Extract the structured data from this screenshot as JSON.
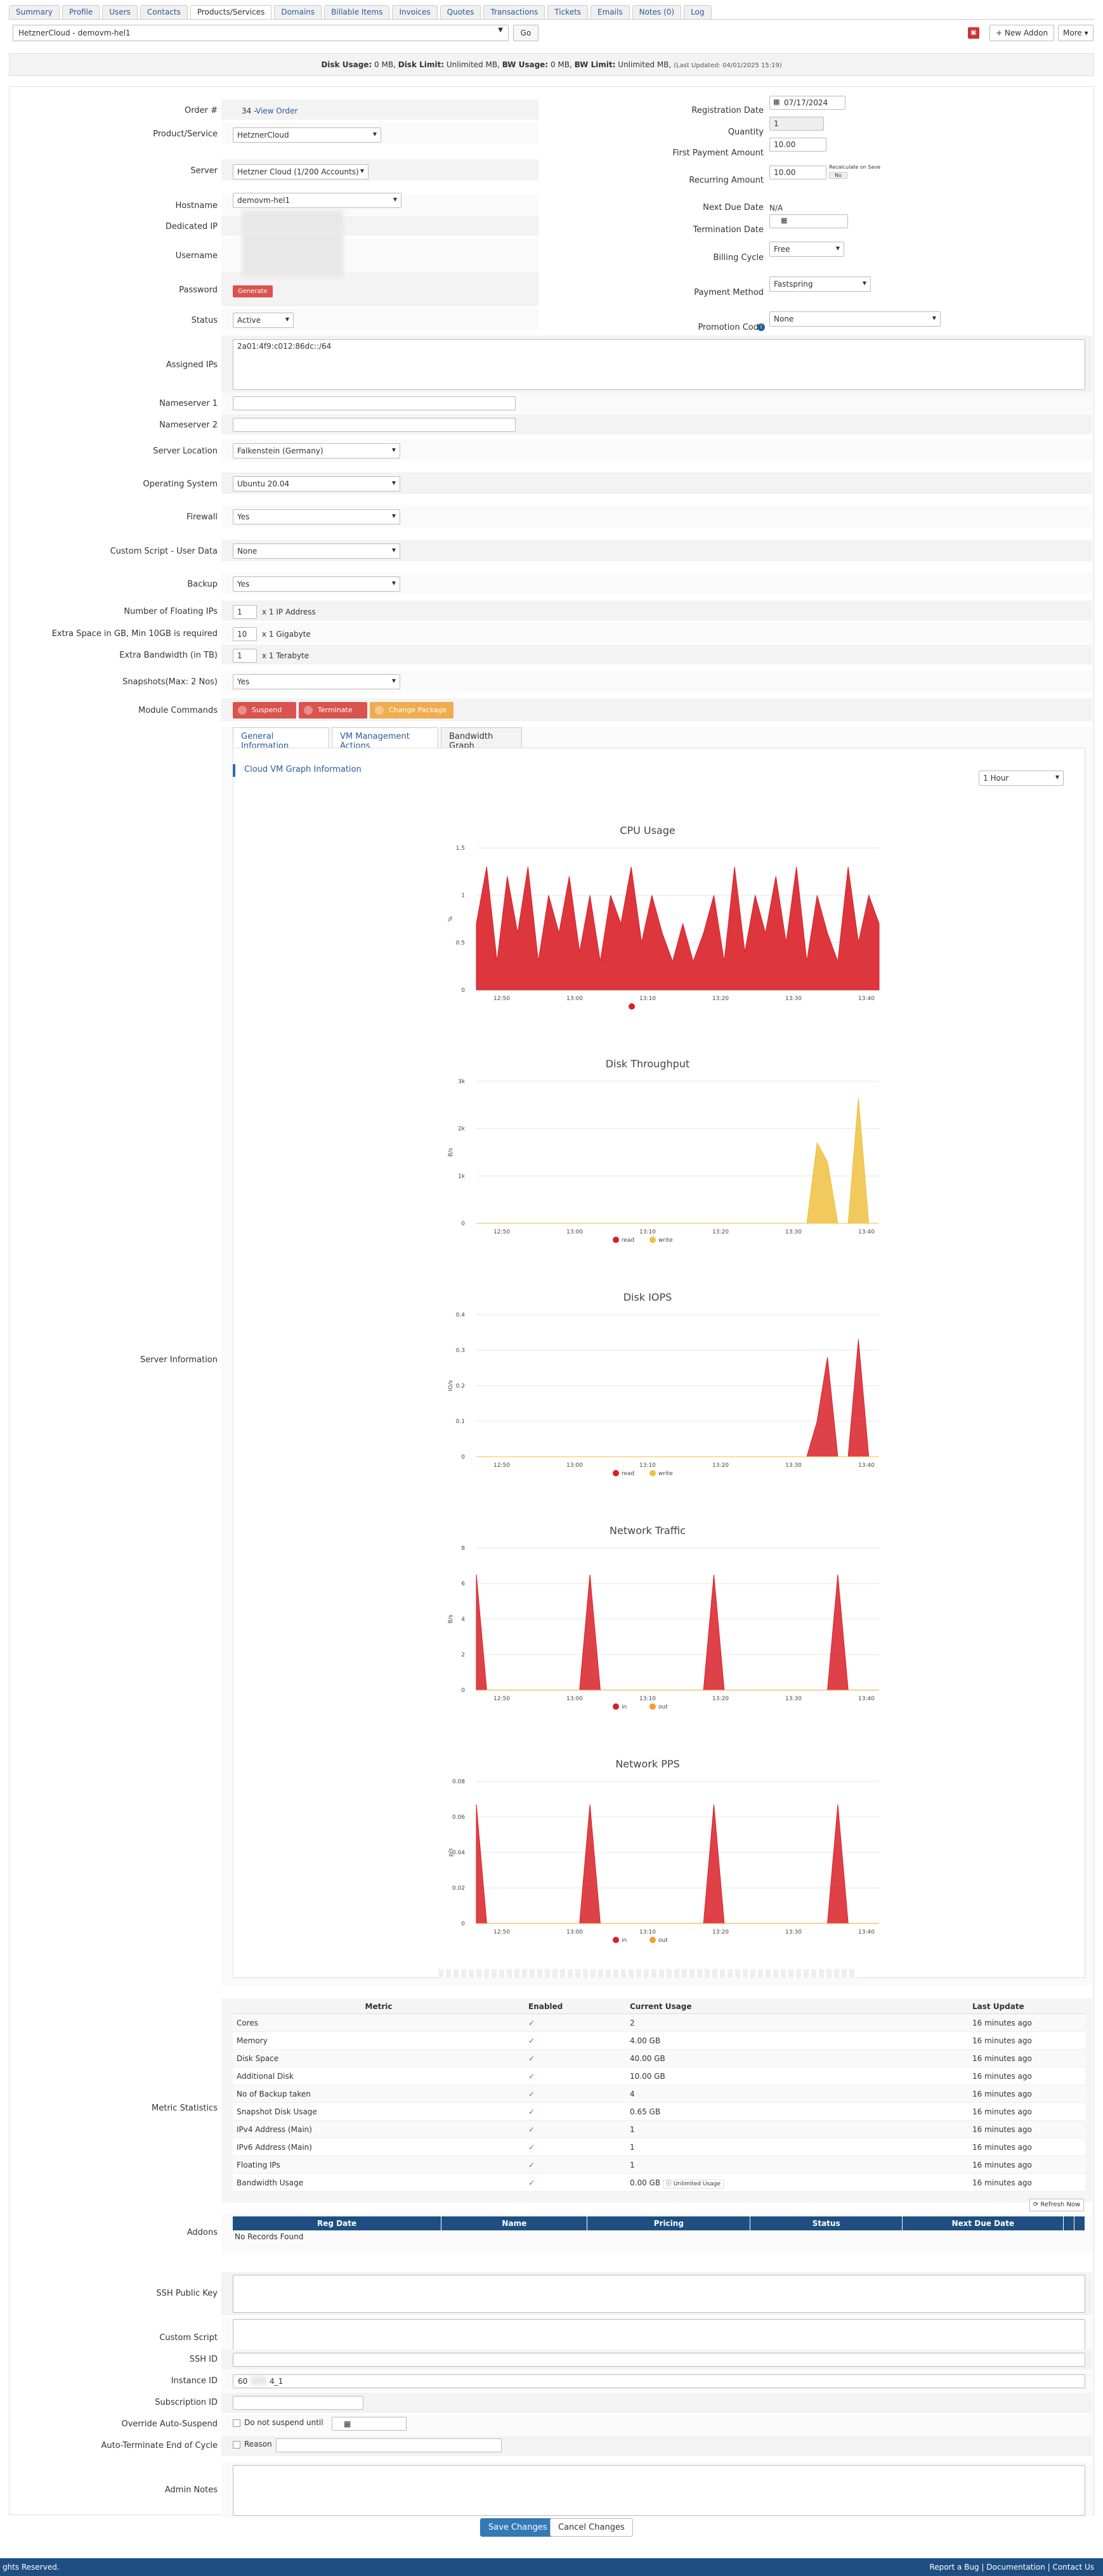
{
  "tabs": [
    "Summary",
    "Profile",
    "Users",
    "Contacts",
    "Products/Services",
    "Domains",
    "Billable Items",
    "Invoices",
    "Quotes",
    "Transactions",
    "Tickets",
    "Emails",
    "Notes (0)",
    "Log"
  ],
  "active_tab": 4,
  "service_select": "HetznerCloud - demovm-hel1",
  "go_label": "Go",
  "new_addon_label": "New Addon",
  "more_label": "More",
  "usage": {
    "disk_usage_label": "Disk Usage:",
    "disk_usage": "0 MB,",
    "disk_limit_label": "Disk Limit:",
    "disk_limit": "Unlimited MB,",
    "bw_usage_label": "BW Usage:",
    "bw_usage": "0 MB,",
    "bw_limit_label": "BW Limit:",
    "bw_limit": "Unlimited MB,",
    "updated": "(Last Updated: 04/01/2025 15:19)"
  },
  "form": {
    "order_label": "Order #",
    "order_value": "34 - ",
    "view_order": "View Order",
    "product_label": "Product/Service",
    "product_value": "HetznerCloud",
    "server_label": "Server",
    "server_value": "Hetzner Cloud (1/200 Accounts)",
    "hostname_label": "Hostname",
    "hostname_value": "demovm-hel1",
    "dedicated_ip_label": "Dedicated IP",
    "username_label": "Username",
    "password_label": "Password",
    "generate_label": "Generate",
    "status_label": "Status",
    "status_value": "Active",
    "assigned_ips_label": "Assigned IPs",
    "assigned_ips_value": "2a01:4f9:c012:86dc::/64",
    "ns1_label": "Nameserver 1",
    "ns2_label": "Nameserver 2",
    "location_label": "Server Location",
    "location_value": "Falkenstein (Germany)",
    "os_label": "Operating System",
    "os_value": "Ubuntu 20.04",
    "firewall_label": "Firewall",
    "firewall_value": "Yes",
    "custom_script_label": "Custom Script - User Data",
    "custom_script_value": "None",
    "backup_label": "Backup",
    "backup_value": "Yes",
    "floating_label": "Number of Floating IPs",
    "floating_value": "1",
    "floating_unit": "x 1 IP Address",
    "extra_space_label": "Extra Space in GB, Min 10GB is required",
    "extra_space_value": "10",
    "extra_space_unit": "x 1 Gigabyte",
    "extra_bw_label": "Extra Bandwidth (in TB)",
    "extra_bw_value": "1",
    "extra_bw_unit": "x 1 Terabyte",
    "snapshots_label": "Snapshots(Max: 2 Nos)",
    "snapshots_value": "Yes",
    "module_label": "Module Commands",
    "suspend_label": "Suspend",
    "terminate_label": "Terminate",
    "change_pkg_label": "Change Package",
    "reg_date_label": "Registration Date",
    "reg_date_value": "07/17/2024",
    "quantity_label": "Quantity",
    "quantity_value": "1",
    "first_payment_label": "First Payment Amount",
    "first_payment_value": "10.00",
    "recurring_label": "Recurring Amount",
    "recurring_value": "10.00",
    "recalc_label": "Recalculate on Save",
    "recalc_value": "No",
    "next_due_label": "Next Due Date",
    "next_due_value": "N/A",
    "term_date_label": "Termination Date",
    "billing_cycle_label": "Billing Cycle",
    "billing_cycle_value": "Free",
    "payment_method_label": "Payment Method",
    "payment_method_value": "Fastspring",
    "promo_label": "Promotion Code",
    "promo_value": "None"
  },
  "server_info_label": "Server Information",
  "subtabs": [
    "General Information",
    "VM Management Actions",
    "Bandwidth Graph"
  ],
  "graph_header": "Cloud VM Graph Information",
  "period_value": "1 Hour",
  "chart_data": [
    {
      "type": "area",
      "title": "CPU Usage",
      "ylabel": "%",
      "x": [
        "12:50",
        "13:00",
        "13:10",
        "13:20",
        "13:30",
        "13:40"
      ],
      "ylim": [
        0,
        1.5
      ],
      "yticks": [
        "0",
        "0.5",
        "1",
        "1.5"
      ],
      "series": [
        {
          "values": [
            0.7,
            1.3,
            0.3,
            1.2,
            0.6,
            1.3,
            0.3,
            1.0,
            0.6,
            1.2,
            0.4,
            1.0,
            0.3,
            1.0,
            0.7,
            1.3,
            0.5,
            1.0,
            0.6,
            0.3,
            0.7,
            0.3,
            0.6,
            1.0,
            0.3,
            1.3,
            0.4,
            1.0,
            0.6,
            1.2,
            0.5,
            1.3,
            0.3,
            1.0,
            0.6,
            0.3,
            1.3,
            0.5,
            1.0,
            0.7
          ]
        }
      ],
      "legend": [
        ""
      ],
      "colors": [
        "#d92028"
      ]
    },
    {
      "type": "area",
      "title": "Disk Throughput",
      "ylabel": "B/s",
      "x": [
        "12:50",
        "13:00",
        "13:10",
        "13:20",
        "13:30",
        "13:40"
      ],
      "ylim": [
        0,
        3000
      ],
      "yticks": [
        "0",
        "1k",
        "2k",
        "3k"
      ],
      "series": [
        {
          "values": [
            0,
            0,
            0,
            0,
            0,
            0,
            0,
            0,
            0,
            0,
            0,
            0,
            0,
            0,
            0,
            0,
            0,
            0,
            0,
            0,
            0,
            0,
            0,
            0,
            0,
            0,
            0,
            0,
            0,
            0,
            0,
            0,
            0,
            0,
            0,
            0,
            0,
            0,
            0,
            0
          ]
        },
        {
          "values": [
            0,
            0,
            0,
            0,
            0,
            0,
            0,
            0,
            0,
            0,
            0,
            0,
            0,
            0,
            0,
            0,
            0,
            0,
            0,
            0,
            0,
            0,
            0,
            0,
            0,
            0,
            0,
            0,
            0,
            0,
            0,
            0,
            0,
            1700,
            1300,
            0,
            0,
            2650,
            0,
            0
          ]
        }
      ],
      "legend": [
        "read",
        "write"
      ],
      "colors": [
        "#d92028",
        "#f0c040"
      ]
    },
    {
      "type": "area",
      "title": "Disk IOPS",
      "ylabel": "IO/s",
      "x": [
        "12:50",
        "13:00",
        "13:10",
        "13:20",
        "13:30",
        "13:40"
      ],
      "ylim": [
        0,
        0.4
      ],
      "yticks": [
        "0",
        "0.1",
        "0.2",
        "0.3",
        "0.4"
      ],
      "series": [
        {
          "values": [
            0,
            0,
            0,
            0,
            0,
            0,
            0,
            0,
            0,
            0,
            0,
            0,
            0,
            0,
            0,
            0,
            0,
            0,
            0,
            0,
            0,
            0,
            0,
            0,
            0,
            0,
            0,
            0,
            0,
            0,
            0,
            0,
            0,
            0.1,
            0.28,
            0,
            0,
            0.33,
            0,
            0
          ]
        },
        {
          "values": [
            0,
            0,
            0,
            0,
            0,
            0,
            0,
            0,
            0,
            0,
            0,
            0,
            0,
            0,
            0,
            0,
            0,
            0,
            0,
            0,
            0,
            0,
            0,
            0,
            0,
            0,
            0,
            0,
            0,
            0,
            0,
            0,
            0,
            0,
            0,
            0,
            0,
            0,
            0,
            0
          ]
        }
      ],
      "legend": [
        "read",
        "write"
      ],
      "colors": [
        "#d92028",
        "#f0c040"
      ]
    },
    {
      "type": "area",
      "title": "Network Traffic",
      "ylabel": "B/s",
      "x": [
        "12:50",
        "13:00",
        "13:10",
        "13:20",
        "13:30",
        "13:40"
      ],
      "ylim": [
        0,
        8
      ],
      "yticks": [
        "0",
        "2",
        "4",
        "6",
        "8"
      ],
      "series": [
        {
          "values": [
            6.5,
            0,
            0,
            0,
            0,
            0,
            0,
            0,
            0,
            0,
            0,
            6.5,
            0,
            0,
            0,
            0,
            0,
            0,
            0,
            0,
            0,
            0,
            0,
            6.5,
            0,
            0,
            0,
            0,
            0,
            0,
            0,
            0,
            0,
            0,
            0,
            6.5,
            0,
            0,
            0,
            0
          ]
        },
        {
          "values": [
            0,
            0,
            0,
            0,
            0,
            0,
            0,
            0,
            0,
            0,
            0,
            0,
            0,
            0,
            0,
            0,
            0,
            0,
            0,
            0,
            0,
            0,
            0,
            0,
            0,
            0,
            0,
            0,
            0,
            0,
            0,
            0,
            0,
            0,
            0,
            0,
            0,
            0,
            0,
            0
          ]
        }
      ],
      "legend": [
        "in",
        "out"
      ],
      "colors": [
        "#d92028",
        "#f0a030"
      ]
    },
    {
      "type": "area",
      "title": "Network PPS",
      "ylabel": "p/s",
      "x": [
        "12:50",
        "13:00",
        "13:10",
        "13:20",
        "13:30",
        "13:40"
      ],
      "ylim": [
        0,
        0.08
      ],
      "yticks": [
        "0",
        "0.02",
        "0.04",
        "0.06",
        "0.08"
      ],
      "series": [
        {
          "values": [
            0.067,
            0,
            0,
            0,
            0,
            0,
            0,
            0,
            0,
            0,
            0,
            0.067,
            0,
            0,
            0,
            0,
            0,
            0,
            0,
            0,
            0,
            0,
            0,
            0.067,
            0,
            0,
            0,
            0,
            0,
            0,
            0,
            0,
            0,
            0,
            0,
            0.067,
            0,
            0,
            0,
            0
          ]
        },
        {
          "values": [
            0,
            0,
            0,
            0,
            0,
            0,
            0,
            0,
            0,
            0,
            0,
            0,
            0,
            0,
            0,
            0,
            0,
            0,
            0,
            0,
            0,
            0,
            0,
            0,
            0,
            0,
            0,
            0,
            0,
            0,
            0,
            0,
            0,
            0,
            0,
            0,
            0,
            0,
            0,
            0
          ]
        }
      ],
      "legend": [
        "in",
        "out"
      ],
      "colors": [
        "#d92028",
        "#f0a030"
      ]
    }
  ],
  "metric_label": "Metric Statistics",
  "metrics_headers": [
    "Metric",
    "Enabled",
    "Current Usage",
    "Last Update"
  ],
  "metrics": [
    {
      "name": "Cores",
      "usage": "2",
      "updated": "16 minutes ago"
    },
    {
      "name": "Memory",
      "usage": "4.00 GB",
      "updated": "16 minutes ago"
    },
    {
      "name": "Disk Space",
      "usage": "40.00 GB",
      "updated": "16 minutes ago"
    },
    {
      "name": "Additional Disk",
      "usage": "10.00 GB",
      "updated": "16 minutes ago"
    },
    {
      "name": "No of Backup taken",
      "usage": "4",
      "updated": "16 minutes ago"
    },
    {
      "name": "Snapshot Disk Usage",
      "usage": "0.65 GB",
      "updated": "16 minutes ago"
    },
    {
      "name": "IPv4 Address (Main)",
      "usage": "1",
      "updated": "16 minutes ago"
    },
    {
      "name": "IPv6 Address (Main)",
      "usage": "1",
      "updated": "16 minutes ago"
    },
    {
      "name": "Floating IPs",
      "usage": "1",
      "updated": "16 minutes ago"
    },
    {
      "name": "Bandwidth Usage",
      "usage": "0.00 GB",
      "badge": "Unlimited Usage",
      "updated": "16 minutes ago"
    }
  ],
  "refresh_label": "Refresh Now",
  "addons_label": "Addons",
  "addons_headers": [
    "Reg Date",
    "Name",
    "Pricing",
    "Status",
    "Next Due Date"
  ],
  "addons_empty": "No Records Found",
  "ssh_key_label": "SSH Public Key",
  "custom_script2_label": "Custom Script",
  "ssh_id_label": "SSH ID",
  "instance_id_label": "Instance ID",
  "instance_id_prefix": "60",
  "instance_id_suffix": "4_1",
  "subscription_label": "Subscription ID",
  "override_label": "Override Auto-Suspend",
  "override_text": "Do not suspend until",
  "auto_term_label": "Auto-Terminate End of Cycle",
  "reason_label": "Reason",
  "admin_notes_label": "Admin Notes",
  "save_label": "Save Changes",
  "cancel_label": "Cancel Changes",
  "footer_left": "ghts Reserved.",
  "footer_right": "Report a Bug | Documentation | Contact Us"
}
